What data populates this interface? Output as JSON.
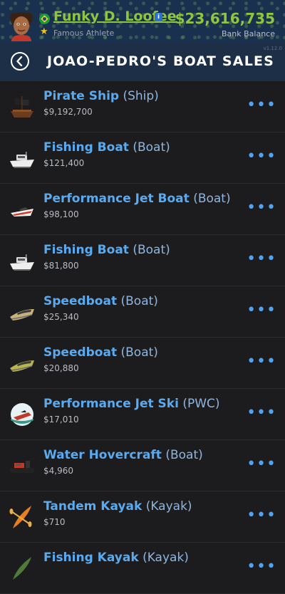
{
  "player": {
    "name": "Funky D. Loofee",
    "info_badge": "i",
    "title": "Famous Athlete",
    "balance": "$23,616,735",
    "balance_label": "Bank Balance"
  },
  "header": {
    "title": "JOAO-PEDRO'S BOAT SALES",
    "version": "v1.12.0"
  },
  "colors": {
    "money_green": "#8ec63f",
    "item_blue": "#5aaaf0",
    "header_bg": "#1d2f47",
    "list_bg": "#1c1c1e"
  },
  "listings": [
    {
      "name": "Pirate Ship",
      "type": "(Ship)",
      "price": "$9,192,700",
      "icon": "pirate-ship-icon",
      "more": "•••"
    },
    {
      "name": "Fishing Boat",
      "type": "(Boat)",
      "price": "$121,400",
      "icon": "fishing-boat-icon",
      "more": "•••"
    },
    {
      "name": "Performance Jet Boat",
      "type": "(Boat)",
      "price": "$98,100",
      "icon": "jet-boat-icon",
      "more": "•••"
    },
    {
      "name": "Fishing Boat",
      "type": "(Boat)",
      "price": "$81,800",
      "icon": "fishing-boat-icon",
      "more": "•••"
    },
    {
      "name": "Speedboat",
      "type": "(Boat)",
      "price": "$25,340",
      "icon": "speedboat-icon",
      "more": "•••"
    },
    {
      "name": "Speedboat",
      "type": "(Boat)",
      "price": "$20,880",
      "icon": "speedboat-icon",
      "more": "•••"
    },
    {
      "name": "Performance Jet Ski",
      "type": "(PWC)",
      "price": "$17,010",
      "icon": "jet-ski-icon",
      "more": "•••"
    },
    {
      "name": "Water Hovercraft",
      "type": "(Boat)",
      "price": "$4,960",
      "icon": "hovercraft-icon",
      "more": "•••"
    },
    {
      "name": "Tandem Kayak",
      "type": "(Kayak)",
      "price": "$710",
      "icon": "kayak-icon",
      "more": "•••"
    },
    {
      "name": "Fishing Kayak",
      "type": "(Kayak)",
      "price": "",
      "icon": "kayak-icon",
      "more": "•••"
    }
  ]
}
